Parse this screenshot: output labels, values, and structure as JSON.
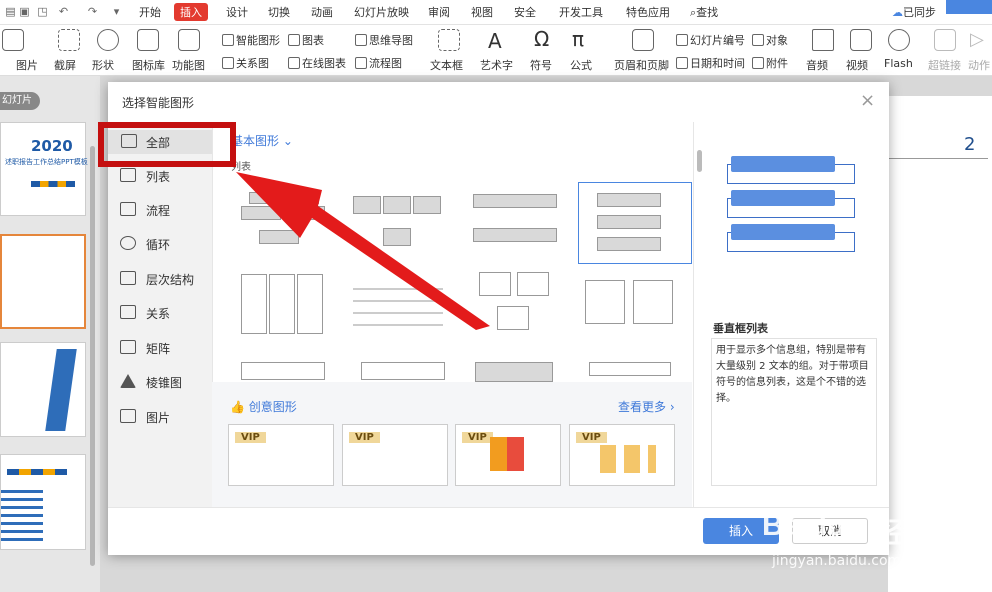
{
  "tabs": [
    "开始",
    "插入",
    "设计",
    "切换",
    "动画",
    "幻灯片放映",
    "审阅",
    "视图",
    "安全",
    "开发工具",
    "特色应用"
  ],
  "active_tab": "插入",
  "search_label": "查找",
  "sync_label": "已同步",
  "toolbar": {
    "picture": "图片",
    "screenshot": "截屏",
    "shapes": "形状",
    "icon_lib": "图标库",
    "function_chart": "功能图",
    "smartart": "智能图形",
    "chart": "图表",
    "relation": "关系图",
    "online_chart": "在线图表",
    "mindmap": "思维导图",
    "flowchart": "流程图",
    "textbox": "文本框",
    "wordart": "艺术字",
    "symbol": "符号",
    "formula": "公式",
    "header_footer": "页眉和页脚",
    "slide_number": "幻灯片编号",
    "object": "对象",
    "datetime": "日期和时间",
    "attachment": "附件",
    "audio": "音频",
    "video": "视频",
    "flash": "Flash",
    "hyperlink": "超链接",
    "action": "动作"
  },
  "slidepane": {
    "tab_label": "幻灯片",
    "thumb1_year": "2020",
    "thumb1_subtitle": "述职报告工作总结PPT模板"
  },
  "canvas_page_number": "2",
  "dialog": {
    "title": "选择智能图形",
    "close_icon": "×",
    "nav": [
      {
        "label": "全部",
        "icon": "all-icon"
      },
      {
        "label": "列表",
        "icon": "list-icon"
      },
      {
        "label": "流程",
        "icon": "process-icon"
      },
      {
        "label": "循环",
        "icon": "cycle-icon"
      },
      {
        "label": "层次结构",
        "icon": "hierarchy-icon"
      },
      {
        "label": "关系",
        "icon": "relation-icon"
      },
      {
        "label": "矩阵",
        "icon": "matrix-icon"
      },
      {
        "label": "棱锥图",
        "icon": "pyramid-icon"
      },
      {
        "label": "图片",
        "icon": "picture-icon"
      }
    ],
    "basic_shapes_label": "基本图形",
    "section_label": "列表",
    "creative_label": "创意图形",
    "see_more": "查看更多",
    "vip_label": "VIP",
    "preview_title": "垂直框列表",
    "preview_desc": "用于显示多个信息组，特别是带有大量级别 2 文本的组。对于带项目符号的信息列表，这是个不错的选择。",
    "insert": "插入",
    "cancel": "取消"
  },
  "watermark": {
    "brand": "Baidu",
    "brand_cn": "经验",
    "url": "jingyan.baidu.com"
  },
  "colors": {
    "accent_red": "#e33a2f",
    "highlight_red": "#c40f0f",
    "primary_blue": "#4a86e0"
  }
}
